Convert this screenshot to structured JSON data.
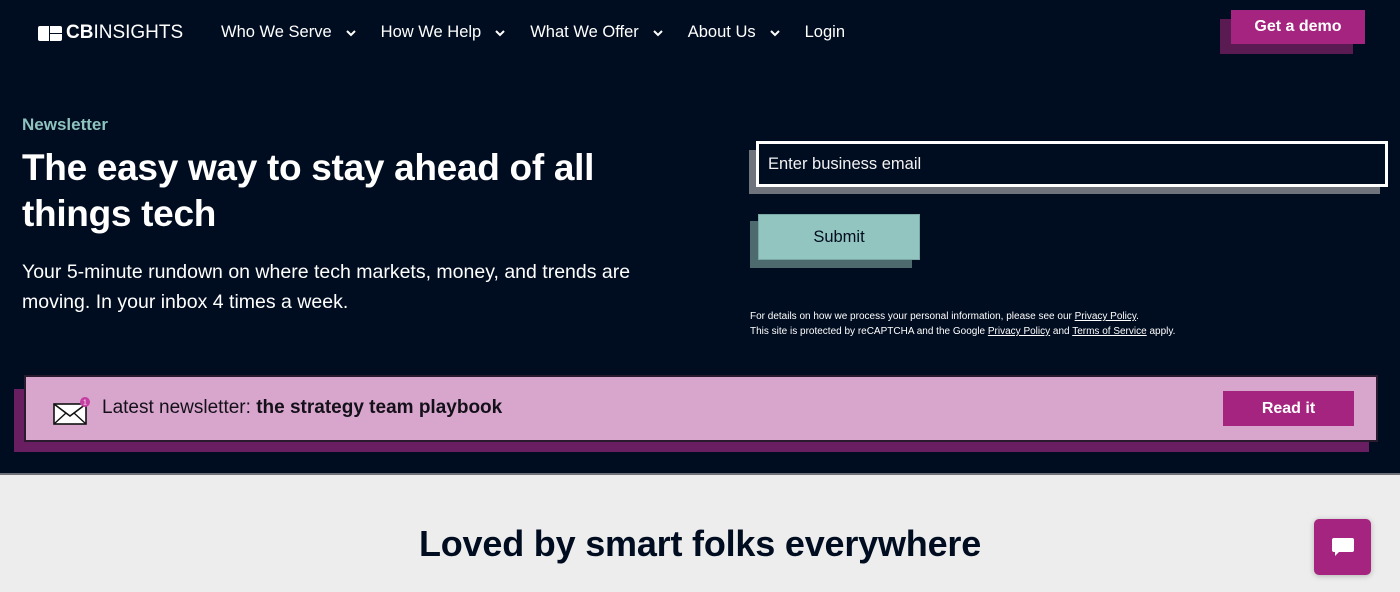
{
  "brand": {
    "logo_bold": "CB",
    "logo_light": "INSIGHTS"
  },
  "nav": {
    "items": [
      {
        "label": "Who We Serve",
        "has_dropdown": true
      },
      {
        "label": "How We Help",
        "has_dropdown": true
      },
      {
        "label": "What We Offer",
        "has_dropdown": true
      },
      {
        "label": "About Us",
        "has_dropdown": true
      },
      {
        "label": "Login",
        "has_dropdown": false
      }
    ],
    "cta_label": "Get a demo"
  },
  "hero": {
    "eyebrow": "Newsletter",
    "headline": "The easy way to stay ahead of all things tech",
    "subhead": "Your 5-minute rundown on where tech markets, money, and trends are moving. In your inbox 4 times a week."
  },
  "form": {
    "email_placeholder": "Enter business email",
    "email_value": "",
    "submit_label": "Submit",
    "legal": {
      "line1_prefix": "For details on how we process your personal information, please see our ",
      "line1_link": "Privacy Policy",
      "line1_suffix": ".",
      "line2_prefix": "This site is protected by reCAPTCHA and the Google ",
      "line2_link1": "Privacy Policy",
      "line2_mid": " and ",
      "line2_link2": "Terms of Service",
      "line2_suffix": " apply."
    }
  },
  "latest": {
    "icon": "envelope-icon",
    "badge_count": "1",
    "prefix": "Latest newsletter: ",
    "title": "the strategy team playbook",
    "button_label": "Read it"
  },
  "lower": {
    "title": "Loved by smart folks everywhere"
  },
  "chat": {
    "icon": "chat-bubble-icon"
  },
  "colors": {
    "navy": "#000c1f",
    "magenta": "#a5247f",
    "teal": "#93c5c0",
    "pink": "#d8a6cc",
    "light_bg": "#ededed"
  }
}
